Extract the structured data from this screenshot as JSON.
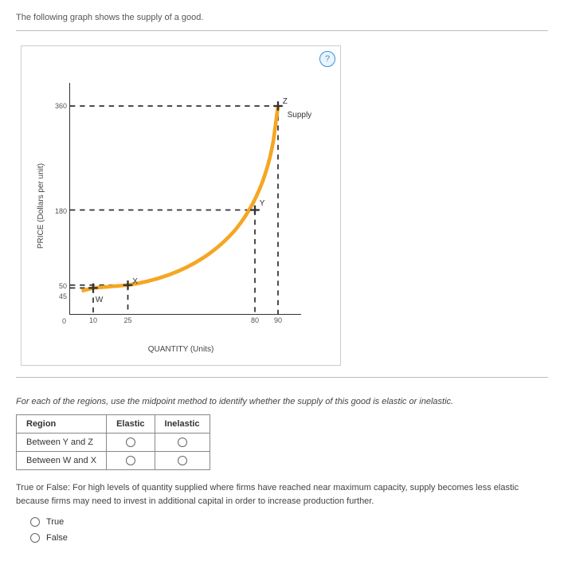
{
  "intro": "The following graph shows the supply of a good.",
  "help_icon": "?",
  "chart_data": {
    "type": "line",
    "title": "",
    "xlabel": "QUANTITY (Units)",
    "ylabel": "PRICE (Dollars per unit)",
    "xlim": [
      0,
      100
    ],
    "ylim": [
      0,
      400
    ],
    "x_ticks": [
      0,
      10,
      25,
      80,
      90
    ],
    "y_ticks": [
      45,
      50,
      180,
      360
    ],
    "series": [
      {
        "name": "Supply",
        "color": "#f5a623",
        "x": [
          5,
          10,
          25,
          50,
          70,
          80,
          85,
          88,
          90
        ],
        "y": [
          40,
          45,
          50,
          80,
          130,
          180,
          240,
          300,
          360
        ]
      }
    ],
    "points": [
      {
        "name": "W",
        "x": 10,
        "y": 45
      },
      {
        "name": "X",
        "x": 25,
        "y": 50
      },
      {
        "name": "Y",
        "x": 80,
        "y": 180
      },
      {
        "name": "Z",
        "x": 90,
        "y": 360
      }
    ],
    "guide_lines": [
      {
        "to": "W",
        "style": "dashed"
      },
      {
        "to": "X",
        "style": "dashed"
      },
      {
        "to": "Y",
        "style": "dashed"
      },
      {
        "to": "Z",
        "style": "dashed"
      }
    ]
  },
  "q2_prompt": "For each of the regions, use the midpoint method to identify whether the supply of this good is elastic or inelastic.",
  "table": {
    "headers": [
      "Region",
      "Elastic",
      "Inelastic"
    ],
    "rows": [
      {
        "region": "Between Y and Z"
      },
      {
        "region": "Between W and X"
      }
    ]
  },
  "tf": {
    "prompt": "True or False: For high levels of quantity supplied where firms have reached near maximum capacity, supply becomes less elastic because firms may need to invest in additional capital in order to increase production further.",
    "options": [
      "True",
      "False"
    ]
  }
}
